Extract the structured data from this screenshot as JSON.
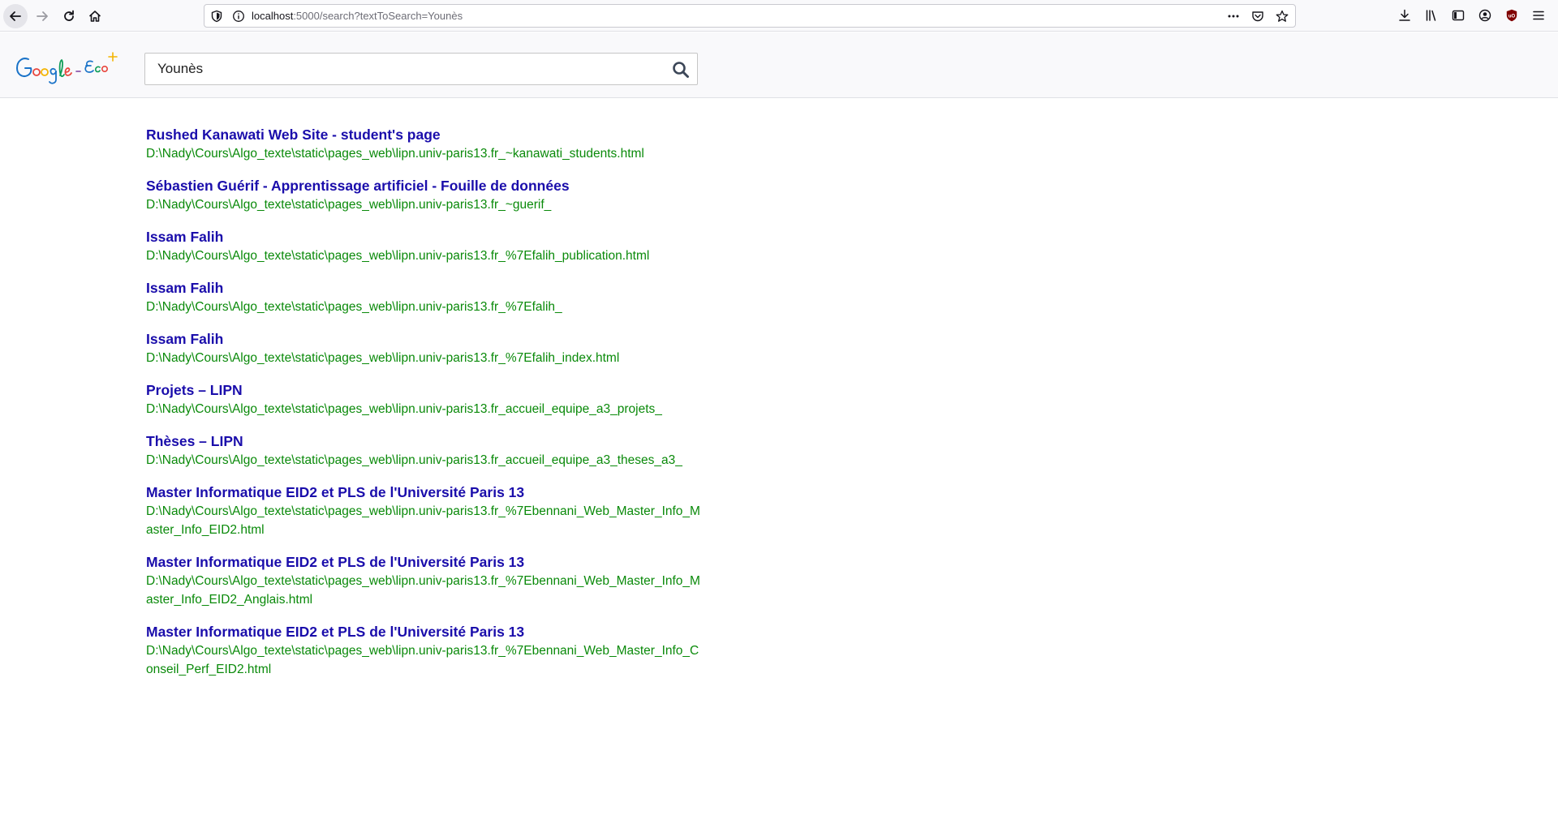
{
  "browser": {
    "url_host": "localhost",
    "url_rest": ":5000/search?textToSearch=Younès"
  },
  "header": {
    "logo_text": "Google - Eco",
    "search_value": "Younès"
  },
  "colors": {
    "result_title": "#1a0dab",
    "result_url": "#0a8a0a"
  },
  "results": [
    {
      "title": "Rushed Kanawati Web Site - student's page",
      "url": "D:\\Nady\\Cours\\Algo_texte\\static\\pages_web\\lipn.univ-paris13.fr_~kanawati_students.html"
    },
    {
      "title": "Sébastien Guérif - Apprentissage artificiel - Fouille de données",
      "url": "D:\\Nady\\Cours\\Algo_texte\\static\\pages_web\\lipn.univ-paris13.fr_~guerif_"
    },
    {
      "title": "Issam Falih",
      "url": "D:\\Nady\\Cours\\Algo_texte\\static\\pages_web\\lipn.univ-paris13.fr_%7Efalih_publication.html"
    },
    {
      "title": "Issam Falih",
      "url": "D:\\Nady\\Cours\\Algo_texte\\static\\pages_web\\lipn.univ-paris13.fr_%7Efalih_"
    },
    {
      "title": "Issam Falih",
      "url": "D:\\Nady\\Cours\\Algo_texte\\static\\pages_web\\lipn.univ-paris13.fr_%7Efalih_index.html"
    },
    {
      "title": "Projets – LIPN",
      "url": "D:\\Nady\\Cours\\Algo_texte\\static\\pages_web\\lipn.univ-paris13.fr_accueil_equipe_a3_projets_"
    },
    {
      "title": "Thèses – LIPN",
      "url": "D:\\Nady\\Cours\\Algo_texte\\static\\pages_web\\lipn.univ-paris13.fr_accueil_equipe_a3_theses_a3_"
    },
    {
      "title": "Master Informatique EID2 et PLS de l'Université Paris 13",
      "url": "D:\\Nady\\Cours\\Algo_texte\\static\\pages_web\\lipn.univ-paris13.fr_%7Ebennani_Web_Master_Info_Master_Info_EID2.html"
    },
    {
      "title": "Master Informatique EID2 et PLS de l'Université Paris 13",
      "url": "D:\\Nady\\Cours\\Algo_texte\\static\\pages_web\\lipn.univ-paris13.fr_%7Ebennani_Web_Master_Info_Master_Info_EID2_Anglais.html"
    },
    {
      "title": "Master Informatique EID2 et PLS de l'Université Paris 13",
      "url": "D:\\Nady\\Cours\\Algo_texte\\static\\pages_web\\lipn.univ-paris13.fr_%7Ebennani_Web_Master_Info_Conseil_Perf_EID2.html"
    }
  ]
}
